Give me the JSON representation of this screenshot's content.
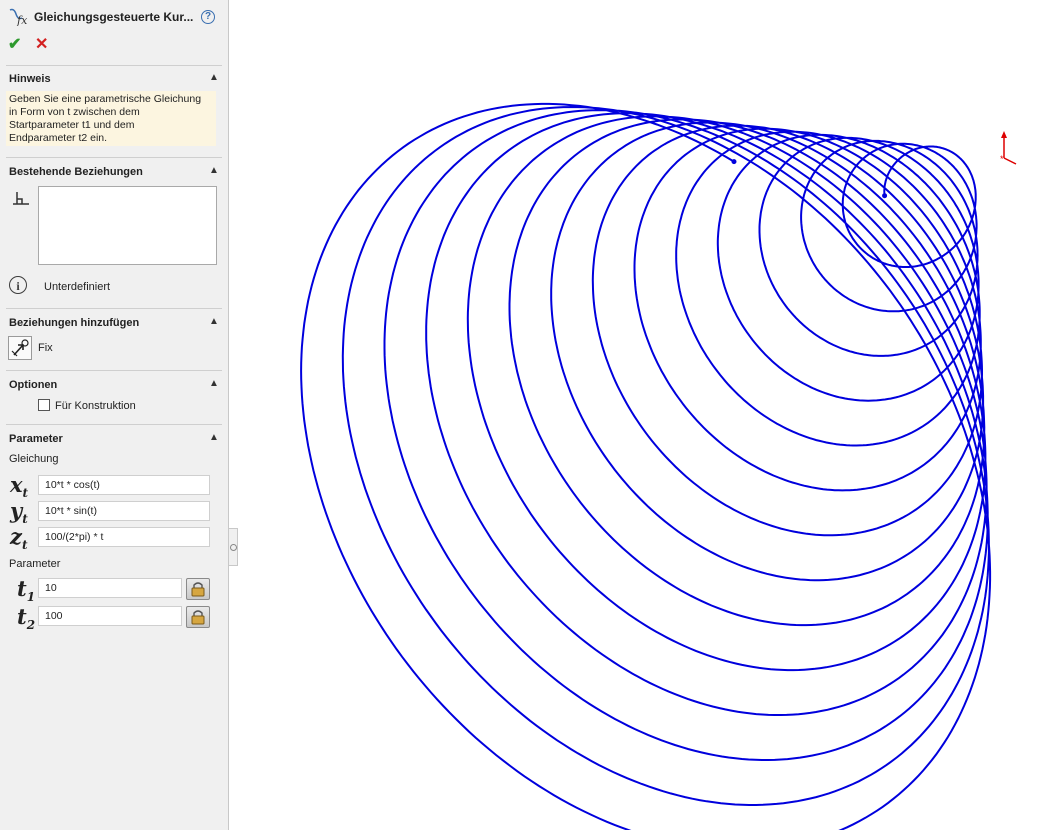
{
  "header": {
    "title": "Gleichungsgesteuerte Kur...",
    "help_symbol": "?",
    "ok_symbol": "✔",
    "cancel_symbol": "✕"
  },
  "hinweis": {
    "heading": "Hinweis",
    "text_lines": [
      "Geben Sie eine parametrische Gleichung",
      "in Form von t zwischen dem",
      "Startparameter t1 und dem",
      "Endparameter t2 ein."
    ]
  },
  "bestehende": {
    "heading": "Bestehende Beziehungen",
    "status": "Unterdefiniert"
  },
  "hinzufuegen": {
    "heading": "Beziehungen hinzufügen",
    "fix_label": "Fix"
  },
  "optionen": {
    "heading": "Optionen",
    "construction_label": "Für Konstruktion",
    "construction_checked": false
  },
  "parameter": {
    "heading": "Parameter",
    "equation_label": "Gleichung",
    "params_label": "Parameter",
    "x_var": "x",
    "x_sub": "t",
    "x_value": "10*t * cos(t)",
    "y_var": "y",
    "y_sub": "t",
    "y_value": "10*t * sin(t)",
    "z_var": "z",
    "z_sub": "t",
    "z_value": "100/(2*pi) * t",
    "t1_var": "t",
    "t1_sub": "1",
    "t1_value": "10",
    "t2_var": "t",
    "t2_sub": "2",
    "t2_value": "100"
  },
  "colors": {
    "curve": "#0000dd",
    "ok": "#2e9a2e",
    "cancel": "#d32020",
    "hint_bg": "#fcf5e0",
    "triad": "#dd0000"
  },
  "icons": [
    "equation-curve-icon",
    "help-icon",
    "check-icon",
    "close-icon",
    "chevron-up-icon",
    "relation-icon",
    "info-icon",
    "fix-relation-icon",
    "lock-icon"
  ]
}
